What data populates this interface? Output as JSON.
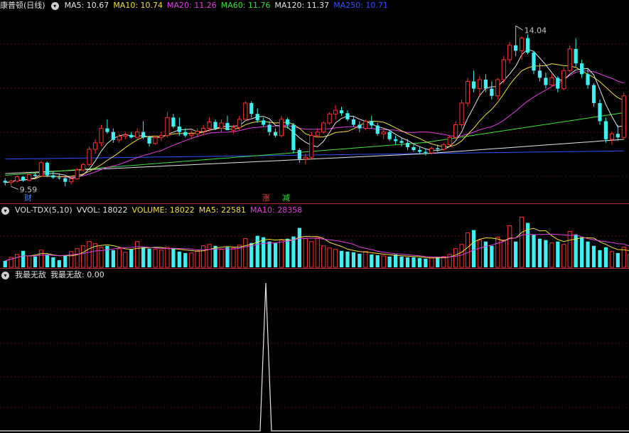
{
  "main": {
    "title": "康普顿(日线)",
    "indicators": [
      {
        "label": "MA5: 10.67",
        "color": "#e6e6e6"
      },
      {
        "label": "MA10: 10.74",
        "color": "#f0e040"
      },
      {
        "label": "MA20: 11.26",
        "color": "#e040e0"
      },
      {
        "label": "MA60: 11.76",
        "color": "#40e040"
      },
      {
        "label": "MA120: 11.37",
        "color": "#e6e6e6"
      },
      {
        "label": "MA250: 10.71",
        "color": "#3050ff"
      }
    ],
    "high_label": "14.04",
    "low_label": "9.59",
    "markers": [
      {
        "text": "财",
        "color": "#5080ff"
      },
      {
        "text": "涨",
        "color": "#ff4040"
      },
      {
        "text": "减",
        "color": "#40e040"
      }
    ]
  },
  "volume_panel": {
    "title": "VOL-TDX(5,10)",
    "indicators": [
      {
        "label": "VVOL: 18022",
        "color": "#e6e6e6"
      },
      {
        "label": "VOLUME: 18022",
        "color": "#f0e040"
      },
      {
        "label": "MA5: 22581",
        "color": "#f0e040"
      },
      {
        "label": "MA10: 28358",
        "color": "#e040e0"
      }
    ]
  },
  "custom_panel": {
    "title": "我最无敌",
    "indicators": [
      {
        "label": "我最无敌: 0.00",
        "color": "#e6e6e6"
      }
    ]
  },
  "chart_data": [
    {
      "type": "candlestick",
      "title": "康普顿(日线)",
      "ylim": [
        9.4,
        14.4
      ],
      "annotations": [
        {
          "text": "14.04",
          "value": 14.04
        },
        {
          "text": "9.59",
          "value": 9.59
        }
      ],
      "candles": [
        [
          9.75,
          9.82,
          9.62,
          9.7
        ],
        [
          9.7,
          9.78,
          9.59,
          9.74
        ],
        [
          9.74,
          9.9,
          9.7,
          9.86
        ],
        [
          9.86,
          9.88,
          9.72,
          9.76
        ],
        [
          9.76,
          9.95,
          9.74,
          9.92
        ],
        [
          9.92,
          10.0,
          9.85,
          9.88
        ],
        [
          9.88,
          10.3,
          9.86,
          10.25
        ],
        [
          10.25,
          10.28,
          9.85,
          9.9
        ],
        [
          9.9,
          10.0,
          9.8,
          9.84
        ],
        [
          9.84,
          9.95,
          9.78,
          9.82
        ],
        [
          9.82,
          9.85,
          9.6,
          9.72
        ],
        [
          9.72,
          9.85,
          9.65,
          9.8
        ],
        [
          9.8,
          10.1,
          9.78,
          10.05
        ],
        [
          10.05,
          10.25,
          10.0,
          10.2
        ],
        [
          10.2,
          10.7,
          10.15,
          10.62
        ],
        [
          10.62,
          10.9,
          10.5,
          10.8
        ],
        [
          10.8,
          11.3,
          10.7,
          11.2
        ],
        [
          11.2,
          11.45,
          11.05,
          11.1
        ],
        [
          11.1,
          11.2,
          10.8,
          10.88
        ],
        [
          10.88,
          11.05,
          10.8,
          10.98
        ],
        [
          10.98,
          11.1,
          10.9,
          11.02
        ],
        [
          11.02,
          11.1,
          10.92,
          10.95
        ],
        [
          10.95,
          11.2,
          10.9,
          11.1
        ],
        [
          11.1,
          11.4,
          10.9,
          10.95
        ],
        [
          10.95,
          11.0,
          10.7,
          10.78
        ],
        [
          10.78,
          11.0,
          10.75,
          10.95
        ],
        [
          10.95,
          11.1,
          10.85,
          11.0
        ],
        [
          11.0,
          11.65,
          10.95,
          11.5
        ],
        [
          11.5,
          11.6,
          11.2,
          11.25
        ],
        [
          11.25,
          11.5,
          11.0,
          11.1
        ],
        [
          11.1,
          11.2,
          10.95,
          11.0
        ],
        [
          11.0,
          11.15,
          10.9,
          11.05
        ],
        [
          11.05,
          11.2,
          10.95,
          11.12
        ],
        [
          11.12,
          11.3,
          11.0,
          11.2
        ],
        [
          11.2,
          11.5,
          11.1,
          11.38
        ],
        [
          11.38,
          11.45,
          11.15,
          11.2
        ],
        [
          11.2,
          11.45,
          11.1,
          11.35
        ],
        [
          11.35,
          11.55,
          11.25,
          11.15
        ],
        [
          11.15,
          11.3,
          11.05,
          11.22
        ],
        [
          11.22,
          11.55,
          11.15,
          11.45
        ],
        [
          11.45,
          11.95,
          11.4,
          11.9
        ],
        [
          11.9,
          11.95,
          11.5,
          11.6
        ],
        [
          11.6,
          11.75,
          11.35,
          11.42
        ],
        [
          11.42,
          11.5,
          11.25,
          11.3
        ],
        [
          11.3,
          11.4,
          11.0,
          11.1
        ],
        [
          11.1,
          11.2,
          10.95,
          11.0
        ],
        [
          11.0,
          11.55,
          10.95,
          11.45
        ],
        [
          11.45,
          11.5,
          11.2,
          11.3
        ],
        [
          11.3,
          11.35,
          10.5,
          10.6
        ],
        [
          10.6,
          10.65,
          10.25,
          10.35
        ],
        [
          10.35,
          10.5,
          10.2,
          10.4
        ],
        [
          10.4,
          11.1,
          10.35,
          11.0
        ],
        [
          11.0,
          11.2,
          10.95,
          11.1
        ],
        [
          11.1,
          11.4,
          11.05,
          11.35
        ],
        [
          11.35,
          11.65,
          11.3,
          11.6
        ],
        [
          11.6,
          11.85,
          11.45,
          11.7
        ],
        [
          11.7,
          11.8,
          11.55,
          11.62
        ],
        [
          11.62,
          11.7,
          11.4,
          11.45
        ],
        [
          11.45,
          11.55,
          11.25,
          11.3
        ],
        [
          11.3,
          11.4,
          11.1,
          11.2
        ],
        [
          11.2,
          11.45,
          11.15,
          11.4
        ],
        [
          11.4,
          11.55,
          11.2,
          11.28
        ],
        [
          11.28,
          11.35,
          11.0,
          11.05
        ],
        [
          11.05,
          11.2,
          10.9,
          11.1
        ],
        [
          11.1,
          11.15,
          10.85,
          10.9
        ],
        [
          10.9,
          11.0,
          10.75,
          10.85
        ],
        [
          10.85,
          10.95,
          10.7,
          10.8
        ],
        [
          10.8,
          10.9,
          10.6,
          10.68
        ],
        [
          10.68,
          10.75,
          10.55,
          10.6
        ],
        [
          10.6,
          10.7,
          10.48,
          10.55
        ],
        [
          10.55,
          10.65,
          10.45,
          10.52
        ],
        [
          10.52,
          10.7,
          10.48,
          10.65
        ],
        [
          10.65,
          10.75,
          10.55,
          10.62
        ],
        [
          10.62,
          10.8,
          10.58,
          10.75
        ],
        [
          10.75,
          11.0,
          10.7,
          10.95
        ],
        [
          10.95,
          11.4,
          10.9,
          11.3
        ],
        [
          11.3,
          12.0,
          11.2,
          11.9
        ],
        [
          11.9,
          12.6,
          11.8,
          12.5
        ],
        [
          12.5,
          12.8,
          12.2,
          12.3
        ],
        [
          12.3,
          12.65,
          12.1,
          12.55
        ],
        [
          12.55,
          12.7,
          12.2,
          12.3
        ],
        [
          12.3,
          12.5,
          12.0,
          12.1
        ],
        [
          12.1,
          12.6,
          12.0,
          12.55
        ],
        [
          12.55,
          13.2,
          12.45,
          13.1
        ],
        [
          13.1,
          13.6,
          13.0,
          13.5
        ],
        [
          13.5,
          14.04,
          13.2,
          13.35
        ],
        [
          13.35,
          13.75,
          13.1,
          13.7
        ],
        [
          13.7,
          13.8,
          13.25,
          13.3
        ],
        [
          13.3,
          13.35,
          12.7,
          12.8
        ],
        [
          12.8,
          13.0,
          12.5,
          12.6
        ],
        [
          12.6,
          12.75,
          12.3,
          12.4
        ],
        [
          12.4,
          12.7,
          12.35,
          12.6
        ],
        [
          12.6,
          12.65,
          12.2,
          12.3
        ],
        [
          12.3,
          12.9,
          12.25,
          12.8
        ],
        [
          12.8,
          13.5,
          12.75,
          13.4
        ],
        [
          13.4,
          13.7,
          12.9,
          13.0
        ],
        [
          13.0,
          13.1,
          12.6,
          12.7
        ],
        [
          12.7,
          12.85,
          12.3,
          12.4
        ],
        [
          12.4,
          12.45,
          11.8,
          11.9
        ],
        [
          11.9,
          12.0,
          11.3,
          11.4
        ],
        [
          11.4,
          11.5,
          10.8,
          10.9
        ],
        [
          10.9,
          11.1,
          10.75,
          11.05
        ],
        [
          11.05,
          11.3,
          10.85,
          10.95
        ],
        [
          10.95,
          12.2,
          10.9,
          12.1
        ]
      ]
    },
    {
      "type": "bar",
      "title": "VOL-TDX(5,10)",
      "series": [
        {
          "name": "VOLUME",
          "values": [
            9000,
            14000,
            18000,
            23000,
            16000,
            15000,
            24000,
            18000,
            14000,
            10000,
            16000,
            22000,
            26000,
            30000,
            36000,
            33000,
            28000,
            30000,
            24000,
            26000,
            21000,
            25000,
            36000,
            28000,
            26000,
            25000,
            24000,
            28000,
            27000,
            22000,
            20000,
            20000,
            23000,
            30000,
            32000,
            30000,
            25000,
            28000,
            27000,
            31000,
            40000,
            34000,
            44000,
            42000,
            36000,
            34000,
            38000,
            40000,
            43000,
            55000,
            40000,
            36000,
            41000,
            30000,
            27000,
            25000,
            23000,
            22000,
            21000,
            19000,
            22000,
            18000,
            17000,
            16000,
            15000,
            18000,
            15000,
            14000,
            14000,
            13000,
            12000,
            13000,
            14000,
            15000,
            18000,
            26000,
            32000,
            48000,
            52000,
            38000,
            36000,
            30000,
            42000,
            38000,
            58000,
            36000,
            70000,
            62000,
            46000,
            40000,
            38000,
            34000,
            36000,
            32000,
            50000,
            46000,
            42000,
            36000,
            30000,
            24000,
            28000,
            22000,
            20000,
            28000,
            18022
          ]
        }
      ]
    },
    {
      "type": "line",
      "title": "我最无敌",
      "series": [
        {
          "name": "我最无敌",
          "values": [
            0,
            0,
            0,
            0,
            0,
            0,
            0,
            0,
            0,
            0,
            0,
            0,
            0,
            0,
            0,
            0,
            0,
            0,
            0,
            0,
            0,
            0,
            0,
            0,
            0,
            0,
            0,
            0,
            0,
            0,
            0,
            0,
            0,
            0,
            0,
            0,
            0,
            0,
            0,
            0,
            0,
            0,
            0,
            0,
            0,
            0,
            0,
            0,
            0,
            0,
            0,
            0,
            0,
            0,
            0,
            0,
            0,
            0,
            0,
            0,
            0,
            0,
            0,
            0,
            0,
            0,
            0,
            0,
            0,
            0,
            0,
            0,
            0,
            0,
            0,
            0,
            0,
            0,
            0,
            0,
            0,
            0,
            0,
            0,
            0,
            0,
            0,
            0,
            0,
            0,
            0,
            0,
            0,
            0,
            0,
            0,
            0,
            0,
            0,
            0,
            0,
            0,
            0,
            0,
            0
          ]
        }
      ],
      "spike": {
        "index": 50,
        "value": 1
      }
    }
  ]
}
